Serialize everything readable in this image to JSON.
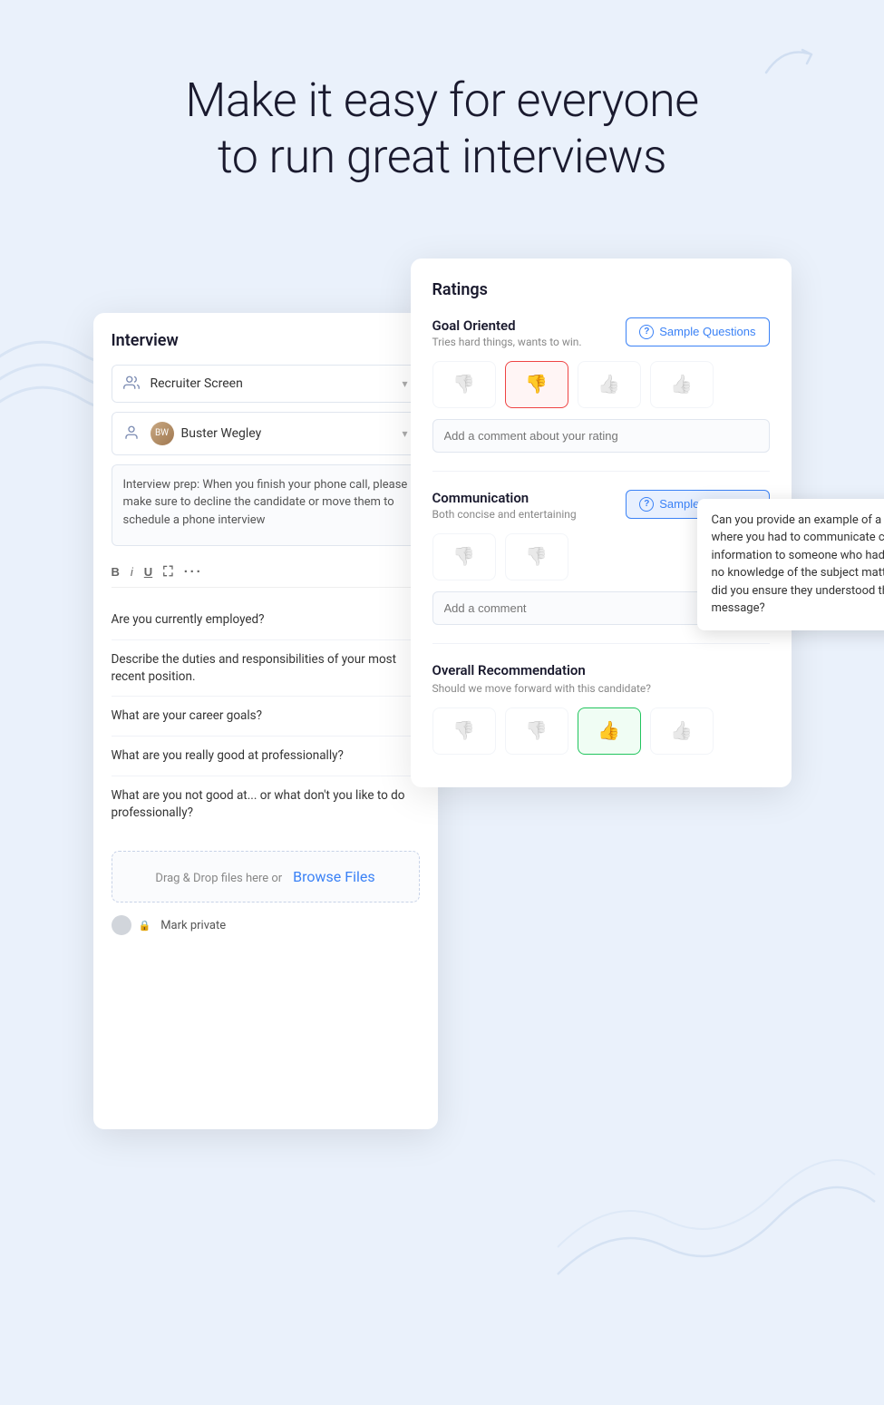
{
  "hero": {
    "title_line1": "Make it easy for everyone",
    "title_line2": "to run great interviews"
  },
  "interview_panel": {
    "title": "Interview",
    "recruiter_field": {
      "label": "Recruiter Screen",
      "icon": "users-icon"
    },
    "interviewer_field": {
      "label": "Buster Wegley",
      "icon": "person-icon"
    },
    "notes_content": "Interview prep:\nWhen you finish your phone call, please make sure to decline the candidate or move them to schedule a phone interview",
    "toolbar": {
      "bold": "B",
      "italic": "i",
      "underline": "U"
    },
    "questions": [
      "Are you currently employed?",
      "Describe the duties and responsibilities of your most recent position.",
      "What are your career goals?",
      "What are you really good at professionally?",
      "What are you not good at... or what don't you like to do professionally?"
    ],
    "file_upload": {
      "drag_text": "Drag & Drop files here or",
      "browse_label": "Browse Files"
    },
    "mark_private_label": "Mark private"
  },
  "ratings_panel": {
    "title": "Ratings",
    "sections": [
      {
        "id": "goal-oriented",
        "label": "Goal Oriented",
        "sublabel": "Tries hard things, wants to win.",
        "sample_questions_label": "Sample Questions",
        "selected_rating": 1,
        "comment_placeholder": "Add a comment about your rating",
        "ratings": [
          "thumbs-down-outline",
          "thumbs-down",
          "thumbs-up-outline",
          "thumbs-up-outline-2"
        ]
      },
      {
        "id": "communication",
        "label": "Communication",
        "sublabel": "Both concise and entertaining",
        "sample_questions_label": "Sample Questions",
        "selected_rating": -1,
        "comment_placeholder": "Add a comment",
        "ratings": [
          "thumbs-down-outline",
          "thumbs-down-outline-2",
          "thumbs-up-outline",
          "thumbs-up-outline-2"
        ],
        "tooltip_text": "Can you provide an example of a situation where you had to communicate complex information to someone who had little or no knowledge of the subject matter? How did you ensure they understood the message?"
      }
    ],
    "overall": {
      "label": "Overall Recommendation",
      "sublabel": "Should we move forward with this candidate?",
      "selected_rating": 2,
      "ratings": [
        "thumbs-down-outline",
        "thumbs-down-outline-2",
        "thumbs-up-selected",
        "thumbs-up-outline-2"
      ]
    }
  },
  "icons": {
    "users": "👥",
    "person": "👤",
    "question": "?",
    "lock": "🔒",
    "thumbs_down_red": "👎",
    "thumbs_up_green": "👍",
    "thumbs_down_outline": "👎",
    "thumbs_up_outline": "👍"
  },
  "colors": {
    "background": "#eaf1fb",
    "card_bg": "#ffffff",
    "blue_accent": "#3b82f6",
    "red_rating": "#ef4444",
    "green_rating": "#22c55e",
    "text_primary": "#1a1a2e",
    "text_secondary": "#666666",
    "text_light": "#999999",
    "border": "#e0e6ef"
  }
}
